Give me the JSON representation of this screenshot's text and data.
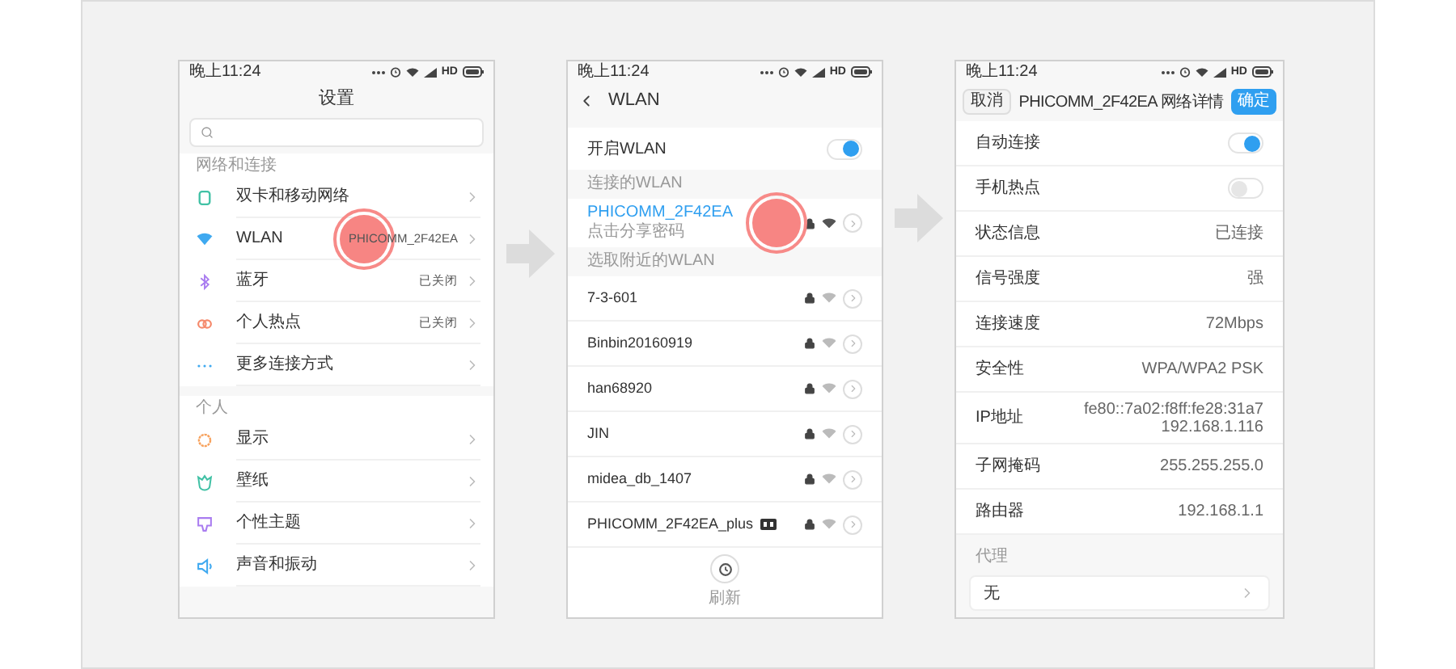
{
  "screens": [
    {
      "kind": "settings",
      "status_bar": {
        "time": "晚上11:24",
        "network": "HD"
      },
      "title": "设置",
      "sections": [
        {
          "label": "网络和连接",
          "items": [
            {
              "label": "双卡和移动网络",
              "tapped": false
            },
            {
              "label": "WLAN",
              "value": "PHICOMM_2F42EA",
              "tapped": true
            },
            {
              "label": "蓝牙",
              "value": "已关闭",
              "tapped": false
            },
            {
              "label": "个人热点",
              "value": "已关闭",
              "tapped": false
            },
            {
              "label": "更多连接方式",
              "tapped": false
            }
          ]
        },
        {
          "label": "个人",
          "items": [
            {
              "label": "显示",
              "tapped": false
            },
            {
              "label": "壁纸",
              "tapped": false
            },
            {
              "label": "个性主题",
              "tapped": false
            },
            {
              "label": "声音和振动",
              "tapped": false
            }
          ]
        }
      ]
    },
    {
      "kind": "wlan",
      "status_bar": {
        "time": "晚上11:24",
        "network": "HD"
      },
      "title": "WLAN",
      "switch": {
        "label": "开启WLAN",
        "on": true
      },
      "connected": {
        "label": "连接的WLAN",
        "networks": [
          {
            "name": "PHICOMM_2F42EA",
            "subtitle": "点击分享密码",
            "tapped": true
          }
        ]
      },
      "nearby": {
        "label": "选取附近的WLAN",
        "networks": [
          {
            "name": "7-3-601",
            "kind": "plain"
          },
          {
            "name": "Binbin20160919",
            "kind": "plain"
          },
          {
            "name": "han68920",
            "kind": "plain"
          },
          {
            "name": "JIN",
            "kind": "plain"
          },
          {
            "name": "midea_db_1407",
            "kind": "plain"
          },
          {
            "name": "PHICOMM_2F42EA_plus",
            "kind": "badge"
          }
        ]
      },
      "refresh": "刷新"
    },
    {
      "kind": "details",
      "status_bar": {
        "time": "晚上11:24",
        "network": "HD"
      },
      "cancel": "取消",
      "title": "PHICOMM_2F42EA 网络详情",
      "confirm": "确定",
      "rows": [
        {
          "kind": "switch",
          "label": "自动连接",
          "on": true
        },
        {
          "kind": "switch",
          "label": "手机热点",
          "on": false
        },
        {
          "kind": "text",
          "label": "状态信息",
          "lines": [
            "已连接"
          ]
        },
        {
          "kind": "text",
          "label": "信号强度",
          "lines": [
            "强"
          ]
        },
        {
          "kind": "text",
          "label": "连接速度",
          "lines": [
            "72Mbps"
          ]
        },
        {
          "kind": "text",
          "label": "安全性",
          "lines": [
            "WPA/WPA2 PSK"
          ]
        },
        {
          "kind": "text",
          "label": "IP地址",
          "lines": [
            "fe80::7a02:f8ff:fe28:31a7",
            "192.168.1.116"
          ]
        },
        {
          "kind": "text",
          "label": "子网掩码",
          "lines": [
            "255.255.255.0"
          ]
        },
        {
          "kind": "text",
          "label": "路由器",
          "lines": [
            "192.168.1.1"
          ]
        }
      ],
      "proxy": {
        "label": "代理",
        "value": "无"
      }
    }
  ]
}
